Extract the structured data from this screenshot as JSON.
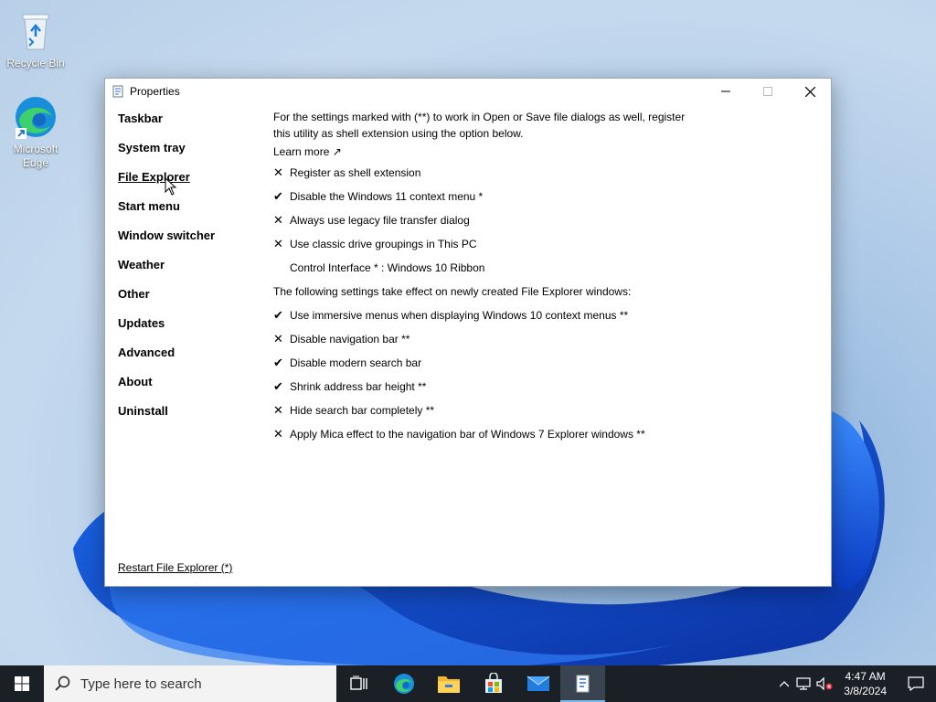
{
  "desktop": {
    "icons": [
      {
        "label": "Recycle Bin",
        "icon": "recycle-bin-icon"
      },
      {
        "label": "Microsoft Edge",
        "icon": "edge-icon"
      }
    ]
  },
  "window": {
    "title": "Properties",
    "nav": [
      {
        "label": "Taskbar"
      },
      {
        "label": "System tray"
      },
      {
        "label": "File Explorer",
        "active": true
      },
      {
        "label": "Start menu"
      },
      {
        "label": "Window switcher"
      },
      {
        "label": "Weather"
      },
      {
        "label": "Other"
      },
      {
        "label": "Updates"
      },
      {
        "label": "Advanced"
      },
      {
        "label": "About"
      },
      {
        "label": "Uninstall"
      }
    ],
    "intro": "For the settings marked with (**) to work in Open or Save file dialogs as well, register this utility as shell extension using the option below.",
    "learn_more": "Learn more ↗",
    "settings_a": [
      {
        "mark": "✕",
        "label": "Register as shell extension"
      },
      {
        "mark": "✔",
        "label": "Disable the Windows 11 context menu *"
      },
      {
        "mark": "✕",
        "label": "Always use legacy file transfer dialog"
      },
      {
        "mark": "✕",
        "label": "Use classic drive groupings in This PC"
      },
      {
        "mark": "",
        "label": "Control Interface * : Windows 10 Ribbon"
      }
    ],
    "note": "The following settings take effect on newly created File Explorer windows:",
    "settings_b": [
      {
        "mark": "✔",
        "label": "Use immersive menus when displaying Windows 10 context menus **"
      },
      {
        "mark": "✕",
        "label": "Disable navigation bar **"
      },
      {
        "mark": "✔",
        "label": "Disable modern search bar"
      },
      {
        "mark": "✔",
        "label": "Shrink address bar height **"
      },
      {
        "mark": "✕",
        "label": "Hide search bar completely **"
      },
      {
        "mark": "✕",
        "label": "Apply Mica effect to the navigation bar of Windows 7 Explorer windows **"
      }
    ],
    "restart": "Restart File Explorer (*)"
  },
  "taskbar": {
    "search_placeholder": "Type here to search",
    "apps": [
      "task-view-icon",
      "edge-icon",
      "file-explorer-icon",
      "store-icon",
      "mail-icon",
      "properties-app-icon"
    ],
    "clock_time": "4:47 AM",
    "clock_date": "3/8/2024"
  }
}
